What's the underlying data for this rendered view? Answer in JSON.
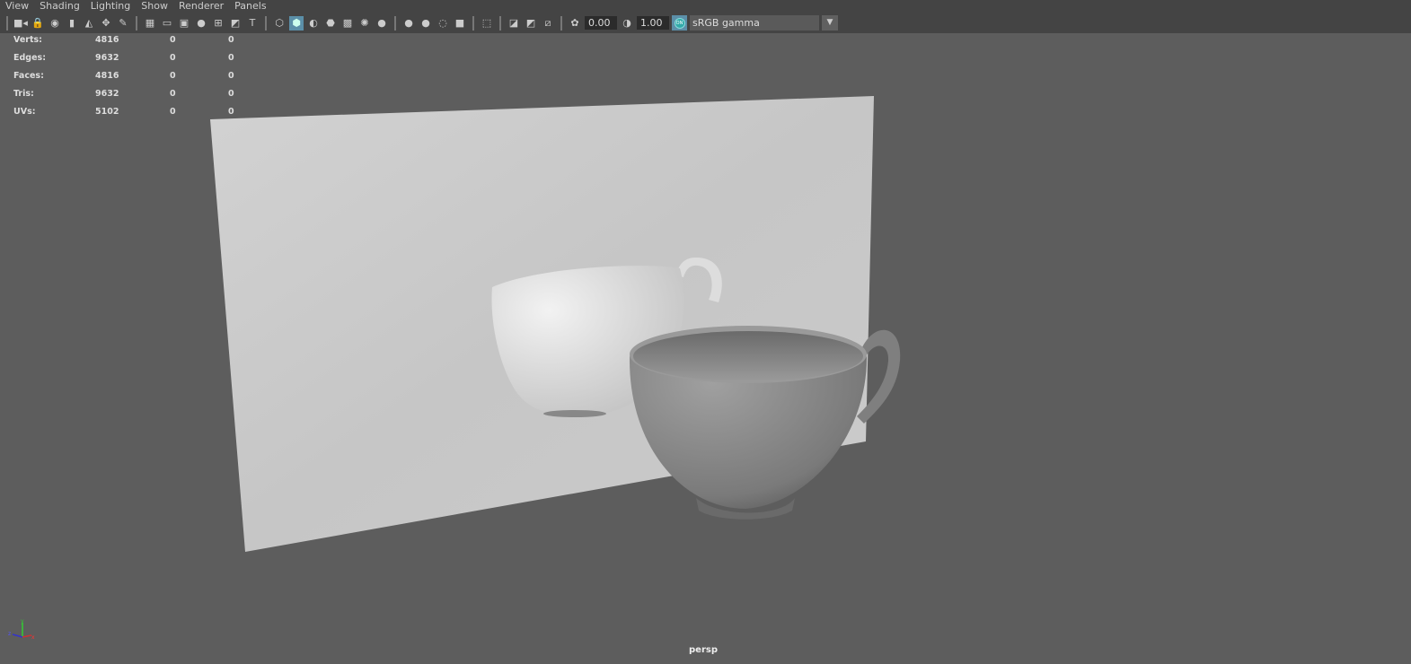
{
  "menu": [
    "View",
    "Shading",
    "Lighting",
    "Show",
    "Renderer",
    "Panels"
  ],
  "toolbar": {
    "groups": [
      [
        "camera-icon",
        "lock-camera-icon",
        "camera-attributes-icon",
        "bookmark-icon",
        "image-plane-icon",
        "2d-pan-zoom-icon",
        "grease-pencil-icon"
      ],
      [
        "grid-icon",
        "film-gate-icon",
        "resolution-gate-icon",
        "gate-mask-icon",
        "field-chart-icon",
        "safe-action-icon",
        "safe-title-icon"
      ],
      [
        "wireframe-icon",
        "smooth-shade-icon",
        "default-material-icon",
        "wireframe-on-shaded-icon",
        "textured-icon",
        "use-lights-icon",
        "shadows-icon"
      ],
      [
        "ambient-occlusion-icon",
        "motion-blur-icon",
        "anti-aliasing-icon",
        "depth-of-field-icon"
      ],
      [
        "isolate-select-icon"
      ],
      [
        "xray-icon",
        "xray-active-icon",
        "xray-joints-icon"
      ]
    ],
    "exposure_icon": "exposure-icon",
    "exposure": "0.00",
    "gamma_icon": "gamma-icon",
    "gamma": "1.00",
    "color_mgmt": "ON",
    "color_space": "sRGB gamma"
  },
  "stats": [
    {
      "label": "Verts:",
      "values": [
        "4816",
        "0",
        "0"
      ]
    },
    {
      "label": "Edges:",
      "values": [
        "9632",
        "0",
        "0"
      ]
    },
    {
      "label": "Faces:",
      "values": [
        "4816",
        "0",
        "0"
      ]
    },
    {
      "label": "Tris:",
      "values": [
        "9632",
        "0",
        "0"
      ]
    },
    {
      "label": "UVs:",
      "values": [
        "5102",
        "0",
        "0"
      ]
    }
  ],
  "camera": "persp",
  "axis": {
    "x": "x",
    "y": "y",
    "z": "z"
  }
}
